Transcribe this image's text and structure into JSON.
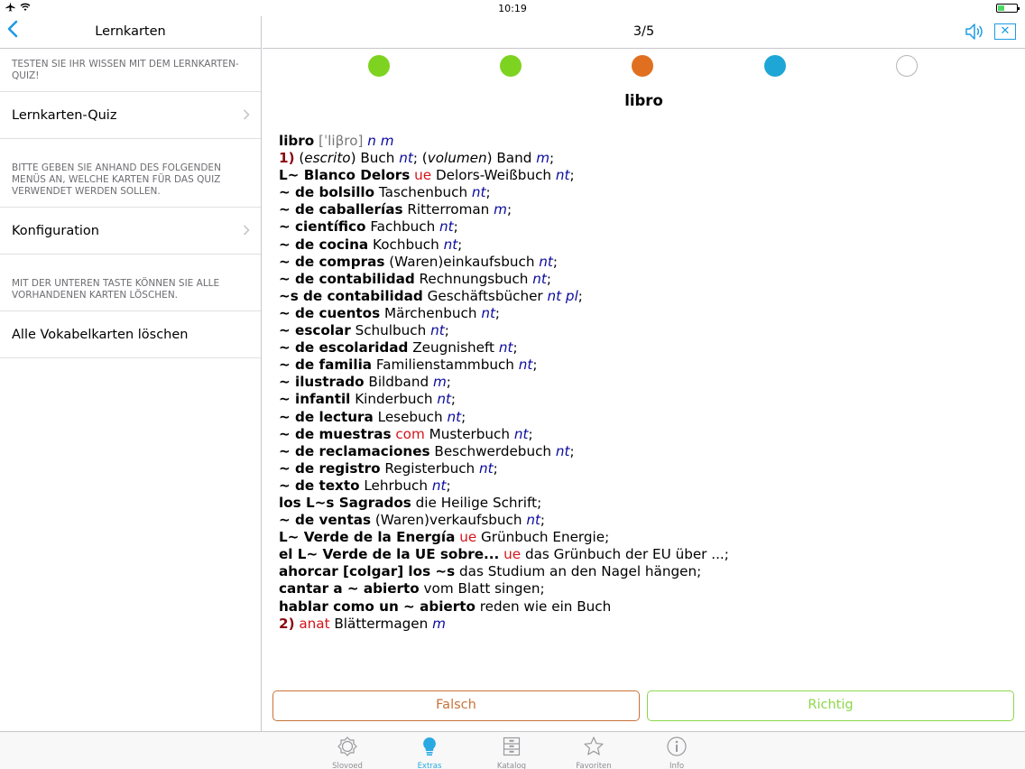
{
  "statusbar": {
    "time": "10:19"
  },
  "left": {
    "title": "Lernkarten",
    "note1": "TESTEN SIE IHR WISSEN MIT DEM LERNKARTEN-QUIZ!",
    "row1": "Lernkarten-Quiz",
    "note2": "BITTE GEBEN SIE ANHAND DES FOLGENDEN MENÜS AN, WELCHE KARTEN FÜR DAS QUIZ VERWENDET WERDEN SOLLEN.",
    "row2": "Konfiguration",
    "note3": "MIT DER UNTEREN TASTE KÖNNEN SIE ALLE VORHANDENEN KARTEN LÖSCHEN.",
    "row3": "Alle Vokabelkarten löschen"
  },
  "right": {
    "counter": "3/5",
    "dots": [
      "#7ed321",
      "#7ed321",
      "#e07020",
      "#1ea6d6",
      "#ffffff"
    ],
    "word": "libro",
    "entry": {
      "headword": "libro",
      "pron": "[ˈliβro]",
      "pos": "n m",
      "sense1_num": "1)",
      "sense1": {
        "paren1": "escrito",
        "trans1": "Buch",
        "g1": "nt",
        "paren2": "volumen",
        "trans2": "Band",
        "g2": "m"
      },
      "lines": [
        {
          "es": "L~ Blanco Delors",
          "label": "ue",
          "de": "Delors-Weißbuch",
          "g": "nt"
        },
        {
          "es": "~ de bolsillo",
          "de": "Taschenbuch",
          "g": "nt"
        },
        {
          "es": "~ de caballerías",
          "de": "Ritterroman",
          "g": "m"
        },
        {
          "es": "~ científico",
          "de": "Fachbuch",
          "g": "nt"
        },
        {
          "es": "~ de cocina",
          "de": "Kochbuch",
          "g": "nt"
        },
        {
          "es": "~ de compras",
          "de": "(Waren)einkaufsbuch",
          "g": "nt"
        },
        {
          "es": "~ de contabilidad",
          "de": "Rechnungsbuch",
          "g": "nt"
        },
        {
          "es": "~s de contabilidad",
          "de": "Geschäftsbücher",
          "g": "nt pl"
        },
        {
          "es": "~ de cuentos",
          "de": "Märchenbuch",
          "g": "nt"
        },
        {
          "es": "~ escolar",
          "de": "Schulbuch",
          "g": "nt"
        },
        {
          "es": "~ de escolaridad",
          "de": "Zeugnisheft",
          "g": "nt"
        },
        {
          "es": "~ de familia",
          "de": "Familienstammbuch",
          "g": "nt"
        },
        {
          "es": "~ ilustrado",
          "de": "Bildband",
          "g": "m"
        },
        {
          "es": "~ infantil",
          "de": "Kinderbuch",
          "g": "nt"
        },
        {
          "es": "~ de lectura",
          "de": "Lesebuch",
          "g": "nt"
        },
        {
          "es": "~ de muestras",
          "label": "com",
          "de": "Musterbuch",
          "g": "nt"
        },
        {
          "es": "~ de reclamaciones",
          "de": "Beschwerdebuch",
          "g": "nt"
        },
        {
          "es": "~ de registro",
          "de": "Registerbuch",
          "g": "nt"
        },
        {
          "es": "~ de texto",
          "de": "Lehrbuch",
          "g": "nt"
        },
        {
          "es": "los L~s Sagrados",
          "de": "die Heilige Schrift"
        },
        {
          "es": "~ de ventas",
          "de": "(Waren)verkaufsbuch",
          "g": "nt"
        },
        {
          "es": "L~ Verde de la Energía",
          "label": "ue",
          "de": "Grünbuch Energie"
        },
        {
          "es": "el L~ Verde de la UE sobre...",
          "label": "ue",
          "de": "das Grünbuch der EU über ..."
        },
        {
          "es_raw": "ahorcar [colgar] los ~s",
          "de": "das Studium an den Nagel hängen"
        },
        {
          "es": "cantar a ~ abierto",
          "de": "vom Blatt singen"
        },
        {
          "es": "hablar como un ~ abierto",
          "de": "reden wie ein Buch",
          "noend": true
        }
      ],
      "sense2_num": "2)",
      "sense2": {
        "label": "anat",
        "de": "Blättermagen",
        "g": "m"
      }
    },
    "btn_falsch": "Falsch",
    "btn_richtig": "Richtig"
  },
  "tabbar": {
    "tabs": [
      {
        "label": "Slovoed",
        "icon": "slovoed-icon"
      },
      {
        "label": "Extras",
        "icon": "lightbulb-icon",
        "active": true
      },
      {
        "label": "Katalog",
        "icon": "catalog-icon"
      },
      {
        "label": "Favoriten",
        "icon": "star-icon"
      },
      {
        "label": "Info",
        "icon": "info-icon"
      }
    ]
  }
}
